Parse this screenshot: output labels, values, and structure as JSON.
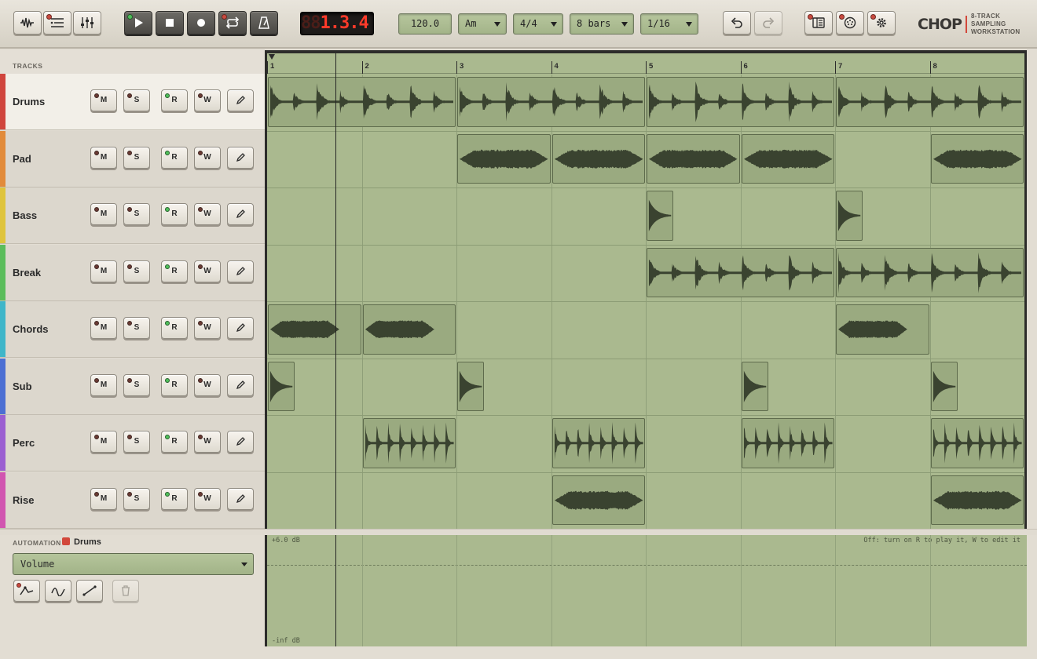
{
  "toolbar": {
    "lcd_ghost": "88",
    "lcd_value": "1.3.4",
    "tempo": "120.0",
    "key": "Am",
    "time_signature": "4/4",
    "length": "8 bars",
    "grid": "1/16"
  },
  "brand": {
    "name": "CHOP",
    "tagline_1": "8-TRACK SAMPLING",
    "tagline_2": "WORKSTATION"
  },
  "tracks_header": "TRACKS",
  "track_button_labels": {
    "mute": "M",
    "solo": "S",
    "read": "R",
    "write": "W"
  },
  "tracks": [
    {
      "name": "Drums",
      "color": "#d0453d",
      "selected": true
    },
    {
      "name": "Pad",
      "color": "#e28b3a"
    },
    {
      "name": "Bass",
      "color": "#dfc43c"
    },
    {
      "name": "Break",
      "color": "#5bbd5b"
    },
    {
      "name": "Chords",
      "color": "#3fb6c9"
    },
    {
      "name": "Sub",
      "color": "#4c6fd3"
    },
    {
      "name": "Perc",
      "color": "#9b5fd1"
    },
    {
      "name": "Rise",
      "color": "#d155b0"
    }
  ],
  "ruler": [
    "1",
    "2",
    "3",
    "4",
    "5",
    "6",
    "7",
    "8"
  ],
  "clips": [
    [
      {
        "start": 0,
        "len": 2,
        "wave": "drum"
      },
      {
        "start": 2,
        "len": 2,
        "wave": "drum"
      },
      {
        "start": 4,
        "len": 2,
        "wave": "drum"
      },
      {
        "start": 6,
        "len": 2,
        "wave": "drum"
      }
    ],
    [
      {
        "start": 2,
        "len": 1,
        "wave": "pad"
      },
      {
        "start": 3,
        "len": 1,
        "wave": "pad"
      },
      {
        "start": 4,
        "len": 1,
        "wave": "pad"
      },
      {
        "start": 5,
        "len": 1,
        "wave": "pad"
      },
      {
        "start": 7,
        "len": 1,
        "wave": "pad"
      }
    ],
    [
      {
        "start": 4,
        "len": 0.3,
        "wave": "hit"
      },
      {
        "start": 6,
        "len": 0.3,
        "wave": "hit"
      }
    ],
    [
      {
        "start": 4,
        "len": 2,
        "wave": "drum"
      },
      {
        "start": 6,
        "len": 2,
        "wave": "drum"
      }
    ],
    [
      {
        "start": 0,
        "len": 1,
        "wave": "chord"
      },
      {
        "start": 1,
        "len": 1,
        "wave": "chord"
      },
      {
        "start": 6,
        "len": 1,
        "wave": "chord"
      }
    ],
    [
      {
        "start": 0,
        "len": 0.3,
        "wave": "hit"
      },
      {
        "start": 2,
        "len": 0.3,
        "wave": "hit"
      },
      {
        "start": 5,
        "len": 0.3,
        "wave": "hit"
      },
      {
        "start": 7,
        "len": 0.3,
        "wave": "hit"
      }
    ],
    [
      {
        "start": 1,
        "len": 1,
        "wave": "perc"
      },
      {
        "start": 3,
        "len": 1,
        "wave": "perc"
      },
      {
        "start": 5,
        "len": 1,
        "wave": "perc"
      },
      {
        "start": 7,
        "len": 1,
        "wave": "perc"
      }
    ],
    [
      {
        "start": 3,
        "len": 1,
        "wave": "pad"
      },
      {
        "start": 7,
        "len": 1,
        "wave": "pad"
      }
    ]
  ],
  "playhead_bar": 0.72,
  "automation": {
    "label": "AUTOMATION",
    "track": "Drums",
    "parameter": "Volume",
    "top_label": "+6.0 dB",
    "bottom_label": "-inf dB",
    "hint": "Off: turn on R to play it, W to edit it"
  },
  "icons": {
    "toolbar_left": [
      "waveform-icon",
      "list-icon",
      "mixer-icon"
    ],
    "transport": [
      "play-icon",
      "stop-icon",
      "record-icon",
      "loop-icon",
      "metronome-icon"
    ],
    "history": [
      "undo-icon",
      "redo-icon"
    ],
    "panels": [
      "browser-icon",
      "midi-icon",
      "settings-icon"
    ],
    "edit": "pencil-icon",
    "automation_tools": [
      "curve-peak-icon",
      "curve-wave-icon",
      "line-ramp-icon",
      "trash-icon"
    ]
  },
  "colors": {
    "lane_bg": "#aab98f",
    "clip_bg": "#9aaa80",
    "waveform": "#3a4330",
    "led_red": "#c94a3f",
    "led_green": "#4fbf5a",
    "lcd": "#ff3a2a"
  }
}
